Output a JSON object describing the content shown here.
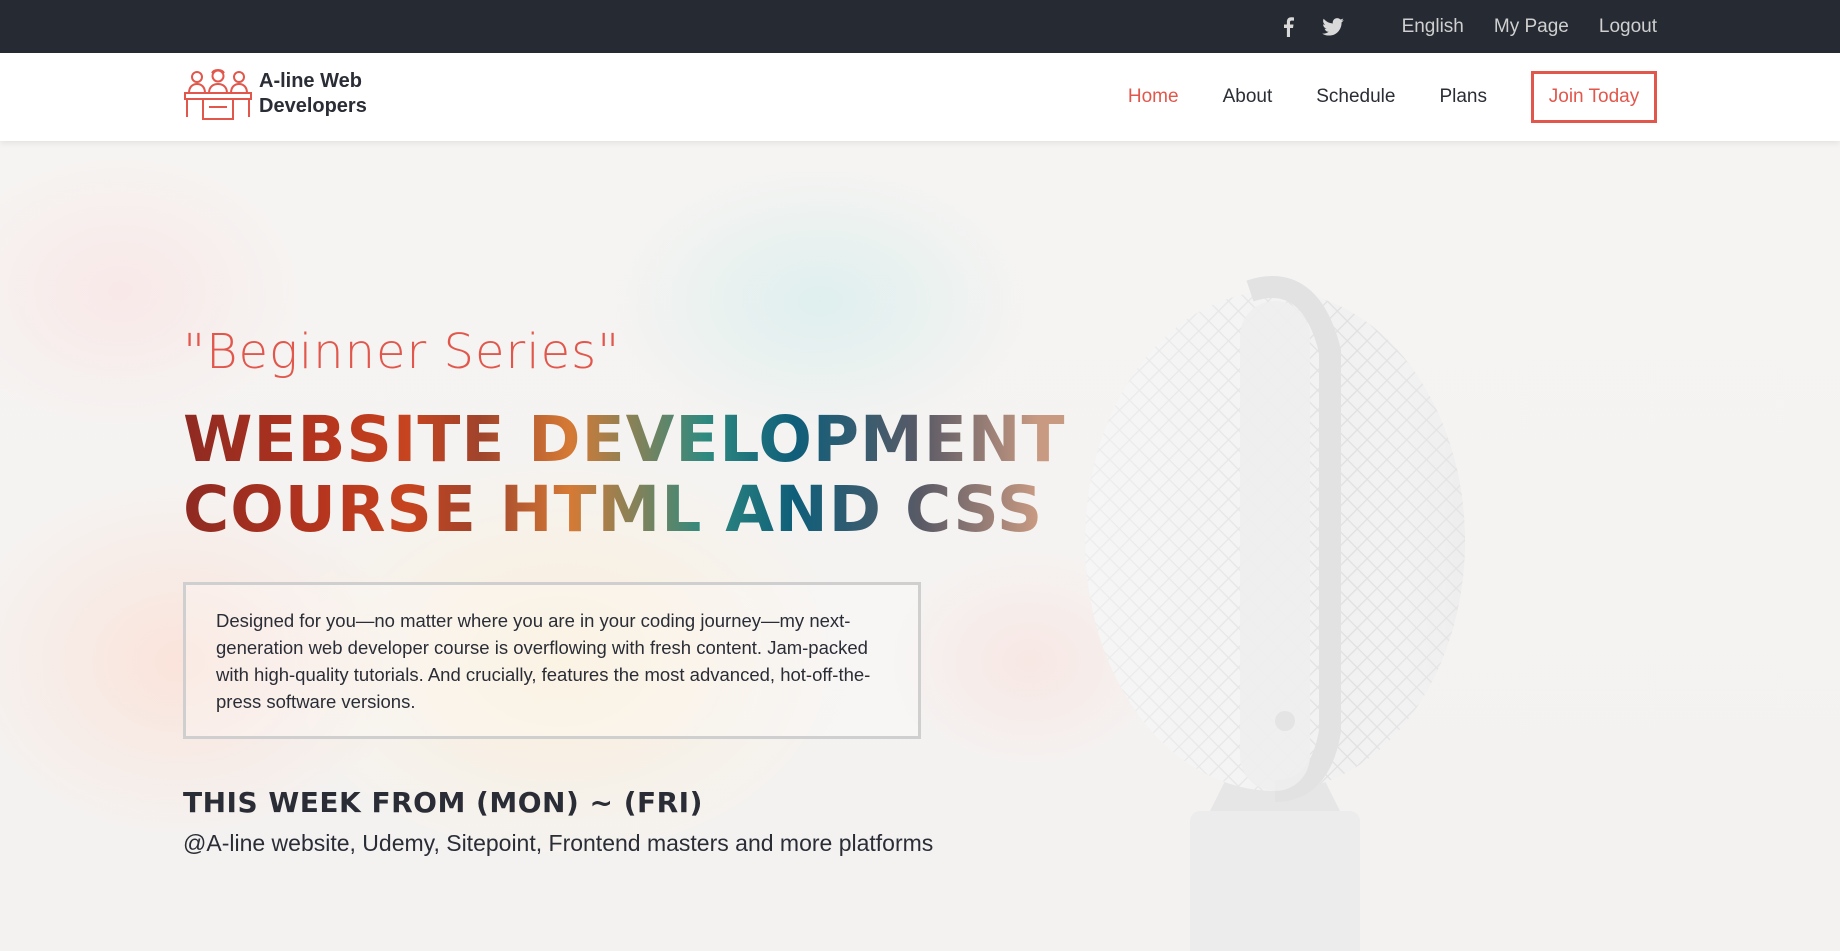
{
  "topbar": {
    "social_icons": [
      "facebook-icon",
      "twitter-icon"
    ],
    "links": [
      "English",
      "My Page",
      "Logout"
    ]
  },
  "brand": {
    "name_line1": "A-line Web",
    "name_line2": "Developers",
    "accent_color": "#e2574c"
  },
  "nav": {
    "items": [
      {
        "label": "Home",
        "active": true
      },
      {
        "label": "About",
        "active": false
      },
      {
        "label": "Schedule",
        "active": false
      },
      {
        "label": "Plans",
        "active": false
      }
    ],
    "cta_label": "Join Today"
  },
  "hero": {
    "subtitle": "\"Beginner Series\"",
    "headline_line1": "WEBSITE DEVELOPMENT",
    "headline_line2": "COURSE HTML AND CSS",
    "description": "Designed for you—no matter where you are in your coding journey—my next-generation web developer course is overflowing with fresh content. Jam-packed with high-quality tutorials. And crucially, features the most advanced, hot-off-the-press software versions.",
    "week_title": "THIS WEEK FROM (MON) ~ (FRI)",
    "week_subtitle": "@A-line website, Udemy, Sitepoint, Frontend masters and more platforms"
  }
}
